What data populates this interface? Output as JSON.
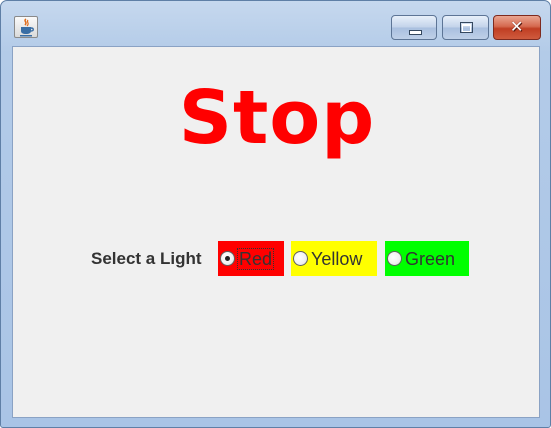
{
  "window": {
    "app_icon": "java-coffee-cup-icon",
    "controls": {
      "minimize_icon": "minimize-icon",
      "maximize_icon": "maximize-icon",
      "close_icon": "close-icon",
      "close_glyph": "✕"
    }
  },
  "content": {
    "title": "Stop",
    "title_color": "#ff0000",
    "select_label": "Select a Light",
    "selected_light": "Red",
    "radios": [
      {
        "label": "Red",
        "background": "#ff0000",
        "checked": true
      },
      {
        "label": "Yellow",
        "background": "#ffff00",
        "checked": false
      },
      {
        "label": "Green",
        "background": "#00ff00",
        "checked": false
      }
    ]
  }
}
